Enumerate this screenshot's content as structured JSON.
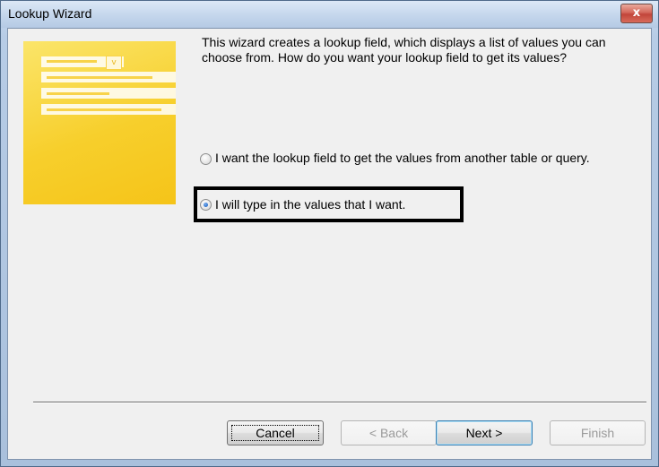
{
  "window": {
    "title": "Lookup Wizard",
    "close_label": "x"
  },
  "wizard": {
    "intro": "This wizard creates a lookup field, which displays a list of values you can choose from.  How do you want your lookup field to get its values?",
    "options": [
      {
        "label": "I want the lookup field to get the values from another table or query.",
        "selected": false
      },
      {
        "label": "I will type in the values that I want.",
        "selected": true
      }
    ],
    "illustration": {
      "dropdown_glyph": "v"
    }
  },
  "buttons": {
    "cancel": "Cancel",
    "back": "< Back",
    "next": "Next >",
    "finish": "Finish"
  },
  "colors": {
    "illustration_yellow": "#f7cf2c",
    "highlight_border": "#000000"
  }
}
